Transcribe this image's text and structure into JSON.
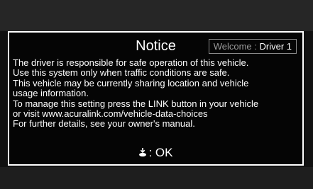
{
  "dialog": {
    "title": "Notice",
    "welcome": {
      "label": "Welcome",
      "separator": " : ",
      "driver": "Driver 1"
    },
    "message_lines": [
      "The driver is responsible for safe operation of this vehicle.",
      "Use this system only when traffic conditions are safe.",
      "This vehicle may be currently sharing location and vehicle",
      "usage information.",
      "To manage this setting press the LINK button in your vehicle",
      "or visit www.acuralink.com/vehicle-data-choices",
      "For further details, see your owner's manual."
    ],
    "ok": {
      "icon": "interface-dial-press-icon",
      "label": ": OK"
    }
  }
}
